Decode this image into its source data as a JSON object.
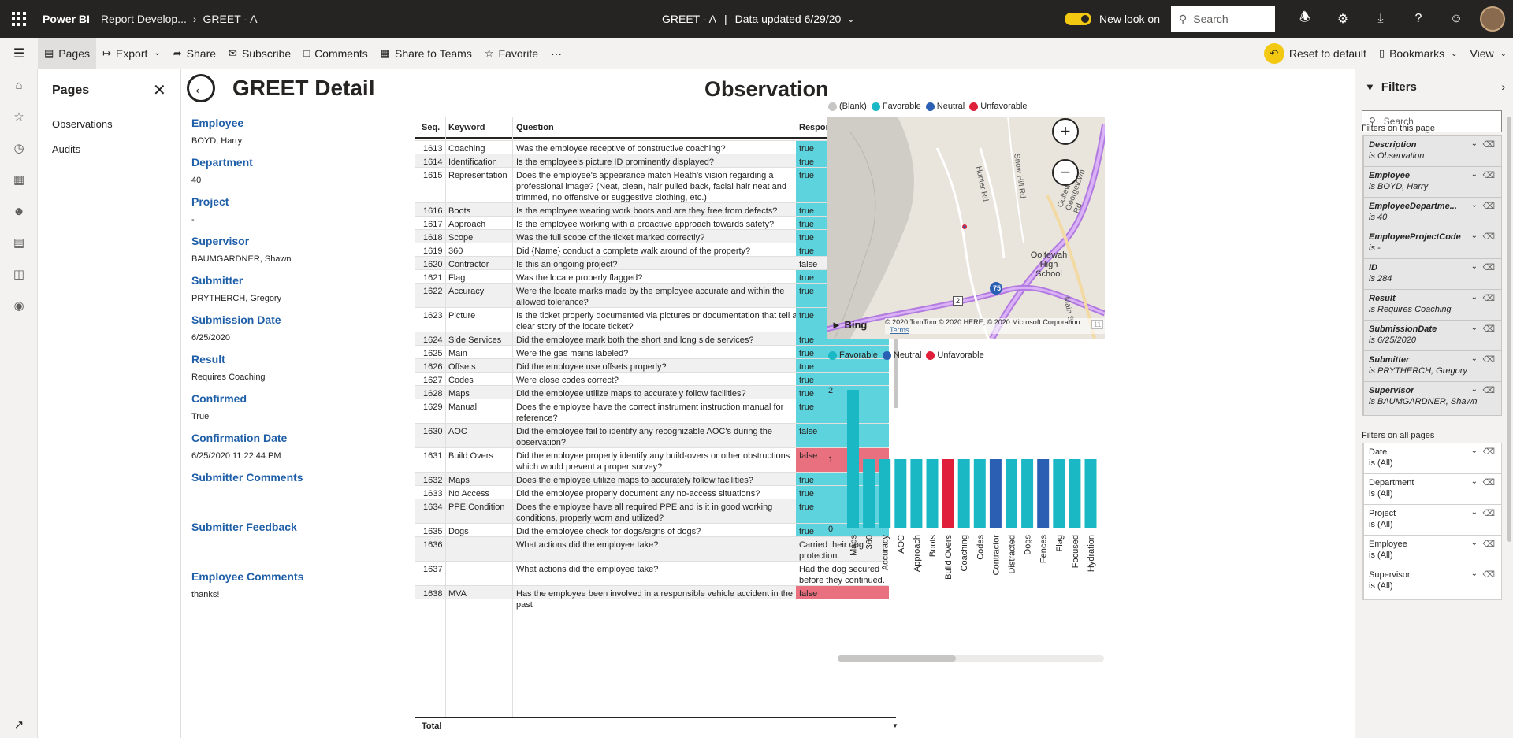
{
  "topbar": {
    "brand": "Power BI",
    "breadcrumb1": "Report Develop...",
    "breadcrumb2": "GREET - A",
    "report_name": "GREET - A",
    "data_updated": "Data updated 6/29/20",
    "new_look": "New look on",
    "search_placeholder": "Search"
  },
  "actionbar": {
    "pages": "Pages",
    "export": "Export",
    "share": "Share",
    "subscribe": "Subscribe",
    "comments": "Comments",
    "share_teams": "Share to Teams",
    "favorite": "Favorite",
    "more": "···",
    "reset": "Reset to default",
    "bookmarks": "Bookmarks",
    "view": "View"
  },
  "pages_pane": {
    "title": "Pages",
    "items": [
      "Observations",
      "Audits"
    ]
  },
  "report": {
    "title": "GREET Detail",
    "observation_title": "Observation"
  },
  "details": [
    {
      "label": "Employee",
      "value": "BOYD, Harry"
    },
    {
      "label": "Department",
      "value": "40"
    },
    {
      "label": "Project",
      "value": "-"
    },
    {
      "label": "Supervisor",
      "value": "BAUMGARDNER, Shawn"
    },
    {
      "label": "Submitter",
      "value": "PRYTHERCH, Gregory"
    },
    {
      "label": "Submission Date",
      "value": "6/25/2020"
    },
    {
      "label": "Result",
      "value": "Requires Coaching"
    },
    {
      "label": "Confirmed",
      "value": "True"
    },
    {
      "label": "Confirmation Date",
      "value": "6/25/2020 11:22:44 PM"
    },
    {
      "label": "Submitter Comments",
      "value": ""
    },
    {
      "label": "Submitter Feedback",
      "value": ""
    },
    {
      "label": "Employee Comments",
      "value": "thanks!"
    }
  ],
  "table": {
    "headers": [
      "Seq.",
      "Keyword",
      "Question",
      "Response"
    ],
    "total_label": "Total",
    "rows": [
      {
        "seq": "1613",
        "keyword": "Coaching",
        "question": "Was the employee receptive of constructive coaching?",
        "response": "true",
        "color": "fav"
      },
      {
        "seq": "1614",
        "keyword": "Identification",
        "question": "Is the employee's picture ID prominently displayed?",
        "response": "true",
        "color": "fav"
      },
      {
        "seq": "1615",
        "keyword": "Representation",
        "question": "Does the employee's appearance match Heath's vision regarding a professional image? (Neat, clean, hair pulled back, facial hair neat and trimmed, no offensive or suggestive clothing, etc.)",
        "response": "true",
        "color": "fav"
      },
      {
        "seq": "1616",
        "keyword": "Boots",
        "question": "Is the employee wearing work boots and are they free from defects?",
        "response": "true",
        "color": "fav"
      },
      {
        "seq": "1617",
        "keyword": "Approach",
        "question": "Is the employee working with a proactive approach towards safety?",
        "response": "true",
        "color": "fav"
      },
      {
        "seq": "1618",
        "keyword": "Scope",
        "question": "Was the full scope of the ticket marked correctly?",
        "response": "true",
        "color": "fav"
      },
      {
        "seq": "1619",
        "keyword": "360",
        "question": "Did {Name} conduct a complete walk around of the property?",
        "response": "true",
        "color": "fav"
      },
      {
        "seq": "1620",
        "keyword": "Contractor",
        "question": "Is this an ongoing project?",
        "response": "false",
        "color": "none"
      },
      {
        "seq": "1621",
        "keyword": "Flag",
        "question": "Was the locate properly flagged?",
        "response": "true",
        "color": "fav"
      },
      {
        "seq": "1622",
        "keyword": "Accuracy",
        "question": "Were the locate marks made by the employee accurate and within the allowed tolerance?",
        "response": "true",
        "color": "fav"
      },
      {
        "seq": "1623",
        "keyword": "Picture",
        "question": "Is the ticket properly documented via pictures or documentation that tell a clear story of the locate ticket?",
        "response": "true",
        "color": "fav"
      },
      {
        "seq": "1624",
        "keyword": "Side Services",
        "question": "Did the employee mark both the short and long side services?",
        "response": "true",
        "color": "fav"
      },
      {
        "seq": "1625",
        "keyword": "Main",
        "question": "Were the gas mains labeled?",
        "response": "true",
        "color": "fav"
      },
      {
        "seq": "1626",
        "keyword": "Offsets",
        "question": "Did the employee use offsets properly?",
        "response": "true",
        "color": "fav"
      },
      {
        "seq": "1627",
        "keyword": "Codes",
        "question": "Were close codes correct?",
        "response": "true",
        "color": "fav"
      },
      {
        "seq": "1628",
        "keyword": "Maps",
        "question": "Did the employee utilize maps to accurately follow facilities?",
        "response": "true",
        "color": "fav"
      },
      {
        "seq": "1629",
        "keyword": "Manual",
        "question": "Does the employee have the correct instrument instruction manual for reference?",
        "response": "true",
        "color": "fav"
      },
      {
        "seq": "1630",
        "keyword": "AOC",
        "question": "Did the employee fail to identify any recognizable AOC's during the observation?",
        "response": "false",
        "color": "fav"
      },
      {
        "seq": "1631",
        "keyword": "Build Overs",
        "question": "Did the employee properly identify any build-overs or other obstructions which would prevent a proper survey?",
        "response": "false",
        "color": "unfav"
      },
      {
        "seq": "1632",
        "keyword": "Maps",
        "question": "Does the employee utilize maps to accurately follow facilities?",
        "response": "true",
        "color": "fav"
      },
      {
        "seq": "1633",
        "keyword": "No Access",
        "question": "Did the employee properly document any no-access situations?",
        "response": "true",
        "color": "fav"
      },
      {
        "seq": "1634",
        "keyword": "PPE Condition",
        "question": "Does the employee have all required PPE and is it in good working conditions, properly worn and utilized?",
        "response": "true",
        "color": "fav"
      },
      {
        "seq": "1635",
        "keyword": "Dogs",
        "question": "Did the employee check for dogs/signs of dogs?",
        "response": "true",
        "color": "fav"
      },
      {
        "seq": "1636",
        "keyword": "",
        "question": "What actions did the employee take?",
        "response": "Carried their dog protection.",
        "color": "none"
      },
      {
        "seq": "1637",
        "keyword": "",
        "question": "What actions did the employee take?",
        "response": "Had the dog secured before they continued.",
        "color": "none"
      },
      {
        "seq": "1638",
        "keyword": "MVA",
        "question": "Has the employee been involved in a responsible vehicle accident in the past",
        "response": "false",
        "color": "unfav"
      }
    ]
  },
  "map": {
    "legend": [
      {
        "label": "(Blank)",
        "color": "#c8c6c4"
      },
      {
        "label": "Favorable",
        "color": "#1ab8c4"
      },
      {
        "label": "Neutral",
        "color": "#2b5fb4"
      },
      {
        "label": "Unfavorable",
        "color": "#e0203a"
      }
    ],
    "bing": "Bing",
    "copyright": "© 2020 TomTom © 2020 HERE, © 2020 Microsoft Corporation",
    "terms": "Terms",
    "labels": [
      "Hunter Rd",
      "Snow Hill Rd",
      "Ooltewah High School",
      "Ooltewah Georgetown Rd",
      "75",
      "2",
      "11",
      "Main St"
    ]
  },
  "chart_data": {
    "type": "bar",
    "legend": [
      {
        "label": "Favorable",
        "color": "#1ab8c4"
      },
      {
        "label": "Neutral",
        "color": "#2b5fb4"
      },
      {
        "label": "Unfavorable",
        "color": "#e0203a"
      }
    ],
    "categories": [
      "Maps",
      "360",
      "Accuracy",
      "AOC",
      "Approach",
      "Boots",
      "Build Overs",
      "Coaching",
      "Codes",
      "Contractor",
      "Distracted",
      "Dogs",
      "Fences",
      "Flag",
      "Focused",
      "Hydration"
    ],
    "values": [
      2,
      1,
      1,
      1,
      1,
      1,
      1,
      1,
      1,
      1,
      1,
      1,
      1,
      1,
      1,
      1
    ],
    "colors": [
      "fav",
      "fav",
      "fav",
      "fav",
      "fav",
      "fav",
      "unfav",
      "fav",
      "fav",
      "neutral",
      "fav",
      "fav",
      "neutral",
      "fav",
      "fav",
      "fav"
    ],
    "yticks": [
      "0",
      "1",
      "2"
    ],
    "ylim": [
      0,
      2
    ]
  },
  "filters": {
    "title": "Filters",
    "search_placeholder": "Search",
    "section_page": "Filters on this page",
    "section_all": "Filters on all pages",
    "page_filters": [
      {
        "name": "Description",
        "value": "is Observation"
      },
      {
        "name": "Employee",
        "value": "is BOYD, Harry"
      },
      {
        "name": "EmployeeDepartme...",
        "value": "is 40"
      },
      {
        "name": "EmployeeProjectCode",
        "value": "is -"
      },
      {
        "name": "ID",
        "value": "is 284"
      },
      {
        "name": "Result",
        "value": "is Requires Coaching"
      },
      {
        "name": "SubmissionDate",
        "value": "is 6/25/2020"
      },
      {
        "name": "Submitter",
        "value": "is PRYTHERCH, Gregory"
      },
      {
        "name": "Supervisor",
        "value": "is BAUMGARDNER, Shawn"
      }
    ],
    "all_filters": [
      {
        "name": "Date",
        "value": "is (All)"
      },
      {
        "name": "Department",
        "value": "is (All)"
      },
      {
        "name": "Project",
        "value": "is (All)"
      },
      {
        "name": "Employee",
        "value": "is (All)"
      },
      {
        "name": "Supervisor",
        "value": "is (All)"
      }
    ]
  },
  "colors": {
    "favorable": "#1ab8c4",
    "favorable_cell": "#5dd3dd",
    "neutral": "#2b5fb4",
    "unfavorable": "#e0203a",
    "unfavorable_cell": "#e8707f",
    "label_blue": "#1f5fa8"
  }
}
